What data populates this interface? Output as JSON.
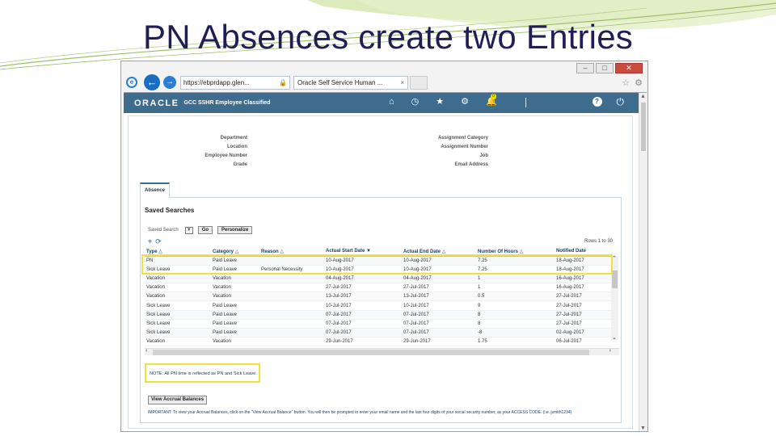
{
  "slide": {
    "title": "PN Absences create two Entries"
  },
  "browser": {
    "window_controls": [
      "–",
      "□",
      "✕"
    ],
    "address_url": "https://ebprdapp.glen...",
    "tab_title": "Oracle Self Service Human ...",
    "tab_close": "×",
    "right_icons": [
      "☆",
      "⚙"
    ]
  },
  "oracle_header": {
    "logo": "ORACLE",
    "app_name": "GCC SSHR Employee Classified",
    "notification_count": "0",
    "icons": [
      "home-icon",
      "clock-icon",
      "star-icon",
      "gear-icon",
      "bell-icon",
      "help-icon",
      "power-icon"
    ]
  },
  "employee_info": {
    "left_labels": [
      "Department",
      "Location",
      "Employee Number",
      "Grade"
    ],
    "right_labels": [
      "Assignment Category",
      "Assignment Number",
      "Job",
      "Email Address"
    ]
  },
  "absence_tab": "Absence",
  "saved_searches": {
    "title": "Saved Searches",
    "saved_search_label": "Saved Search",
    "go_label": "Go",
    "personalize_label": "Personalize",
    "rows_label": "Rows 1 to 30"
  },
  "table": {
    "columns": [
      "Type",
      "Category",
      "Reason",
      "Actual Start Date",
      "Actual End Date",
      "Number Of Hours",
      "Notified Date"
    ],
    "rows": [
      [
        "PN",
        "Paid Leave",
        "",
        "10-Aug-2017",
        "10-Aug-2017",
        "7.25",
        "18-Aug-2017"
      ],
      [
        "Sick Leave",
        "Paid Leave",
        "Personal Necessity",
        "10-Aug-2017",
        "10-Aug-2017",
        "7.25",
        "18-Aug-2017"
      ],
      [
        "Vacation",
        "Vacation",
        "",
        "04-Aug-2017",
        "04-Aug-2017",
        "1",
        "16-Aug-2017"
      ],
      [
        "Vacation",
        "Vacation",
        "",
        "27-Jul-2017",
        "27-Jul-2017",
        "1",
        "16-Aug-2017"
      ],
      [
        "Vacation",
        "Vacation",
        "",
        "13-Jul-2017",
        "13-Jul-2017",
        "0.5",
        "27-Jul-2017"
      ],
      [
        "Sick Leave",
        "Paid Leave",
        "",
        "10-Jul-2017",
        "10-Jul-2017",
        "9",
        "27-Jul-2017"
      ],
      [
        "Sick Leave",
        "Paid Leave",
        "",
        "07-Jul-2017",
        "07-Jul-2017",
        "8",
        "27-Jul-2017"
      ],
      [
        "Sick Leave",
        "Paid Leave",
        "",
        "07-Jul-2017",
        "07-Jul-2017",
        "8",
        "27-Jul-2017"
      ],
      [
        "Sick Leave",
        "Paid Leave",
        "",
        "07-Jul-2017",
        "07-Jul-2017",
        "-8",
        "02-Aug-2017"
      ],
      [
        "Vacation",
        "Vacation",
        "",
        "29-Jun-2017",
        "29-Jun-2017",
        "1.75",
        "06-Jul-2017"
      ]
    ]
  },
  "note": "NOTE: All PN time is reflected as PN and Sick Leave.",
  "accrual_button": "View Accrual Balances",
  "important_text": "IMPORTANT: To view your Accrual Balances, click on the \"View Accrual Balance\" button. You will then be prompted to enter your email name and the last four digits of your social security number, as your ACCESS CODE. (i.e. jsmith1234)",
  "colors": {
    "oracle_bar": "#3d6c8f",
    "highlight": "#f0e040",
    "title_text": "#1f1f55"
  }
}
